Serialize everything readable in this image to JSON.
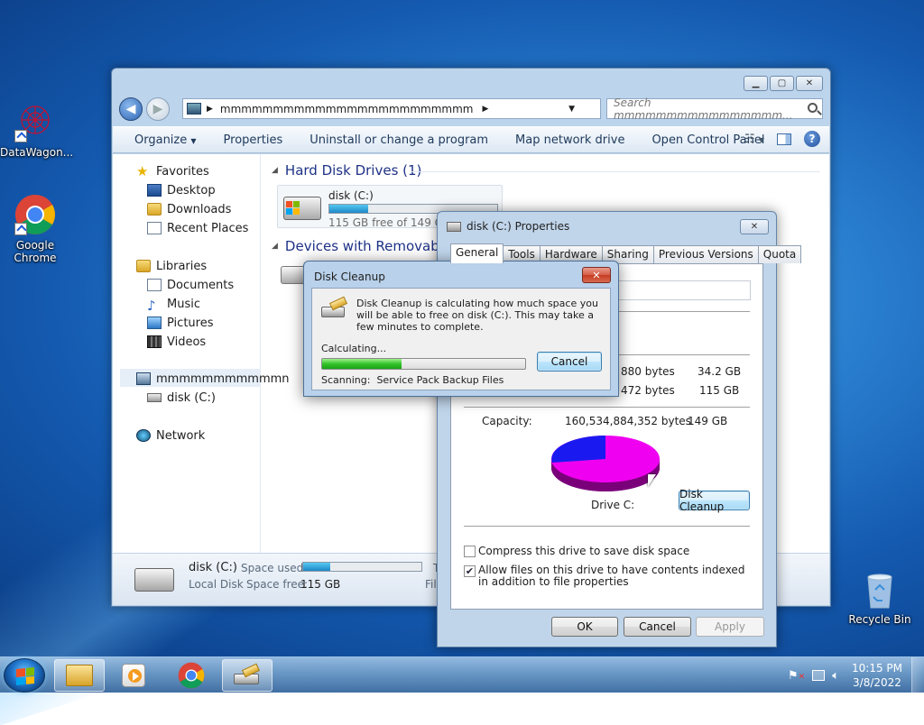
{
  "desktop": {
    "icons": [
      {
        "label": "DataWagon..."
      },
      {
        "label": "Google\nChrome"
      },
      {
        "label": "Recycle Bin"
      }
    ]
  },
  "explorer": {
    "address": "mmmmmmmmmmmmmmmmmmmmmmmm",
    "search_placeholder": "Search mmmmmmmmmmmmmmmm...",
    "toolbar": {
      "organize": "Organize",
      "properties": "Properties",
      "uninstall": "Uninstall or change a program",
      "map_drive": "Map network drive",
      "control_panel": "Open Control Panel"
    },
    "nav": {
      "favorites": "Favorites",
      "desktop": "Desktop",
      "downloads": "Downloads",
      "recent": "Recent Places",
      "libraries": "Libraries",
      "documents": "Documents",
      "music": "Music",
      "pictures": "Pictures",
      "videos": "Videos",
      "computer": "mmmmmmmmmmmn",
      "disk": "disk (C:)",
      "network": "Network"
    },
    "groups": {
      "hdd": "Hard Disk Drives (1)",
      "removable": "Devices with Removable S"
    },
    "drive": {
      "name": "disk (C:)",
      "free_text": "115 GB free of 149 GB",
      "used_fraction": 0.23
    },
    "details": {
      "name": "disk (C:)",
      "type": "Local Disk",
      "space_used_label": "Space used:",
      "space_free_label": "Space free:",
      "space_free_value": "115 GB",
      "trunc_t": "T",
      "trunc_fil": "Fil"
    }
  },
  "properties": {
    "title": "disk (C:) Properties",
    "tabs": [
      "General",
      "Tools",
      "Hardware",
      "Sharing",
      "Previous Versions",
      "Quota"
    ],
    "used_bytes": "880 bytes",
    "used_size": "34.2 GB",
    "free_bytes": "472 bytes",
    "free_size": "115 GB",
    "capacity_label": "Capacity:",
    "capacity_bytes": "160,534,884,352 bytes",
    "capacity_size": "149 GB",
    "drive_label": "Drive C:",
    "disk_cleanup_btn": "Disk Cleanup",
    "compress_label": "Compress this drive to save disk space",
    "compress_checked": false,
    "index_label": "Allow files on this drive to have contents indexed in addition to file properties",
    "index_checked": true,
    "ok": "OK",
    "cancel": "Cancel",
    "apply": "Apply",
    "colors": {
      "used": "#1a1af0",
      "free": "#f000f0"
    }
  },
  "cleanup": {
    "title": "Disk Cleanup",
    "message": "Disk Cleanup is calculating how much space you will be able to free on disk (C:). This may take a few minutes to complete.",
    "status": "Calculating...",
    "progress_fraction": 0.39,
    "scanning_label": "Scanning:",
    "scanning_value": "Service Pack Backup Files",
    "cancel": "Cancel"
  },
  "taskbar": {
    "time": "10:15 PM",
    "date": "3/8/2022"
  }
}
